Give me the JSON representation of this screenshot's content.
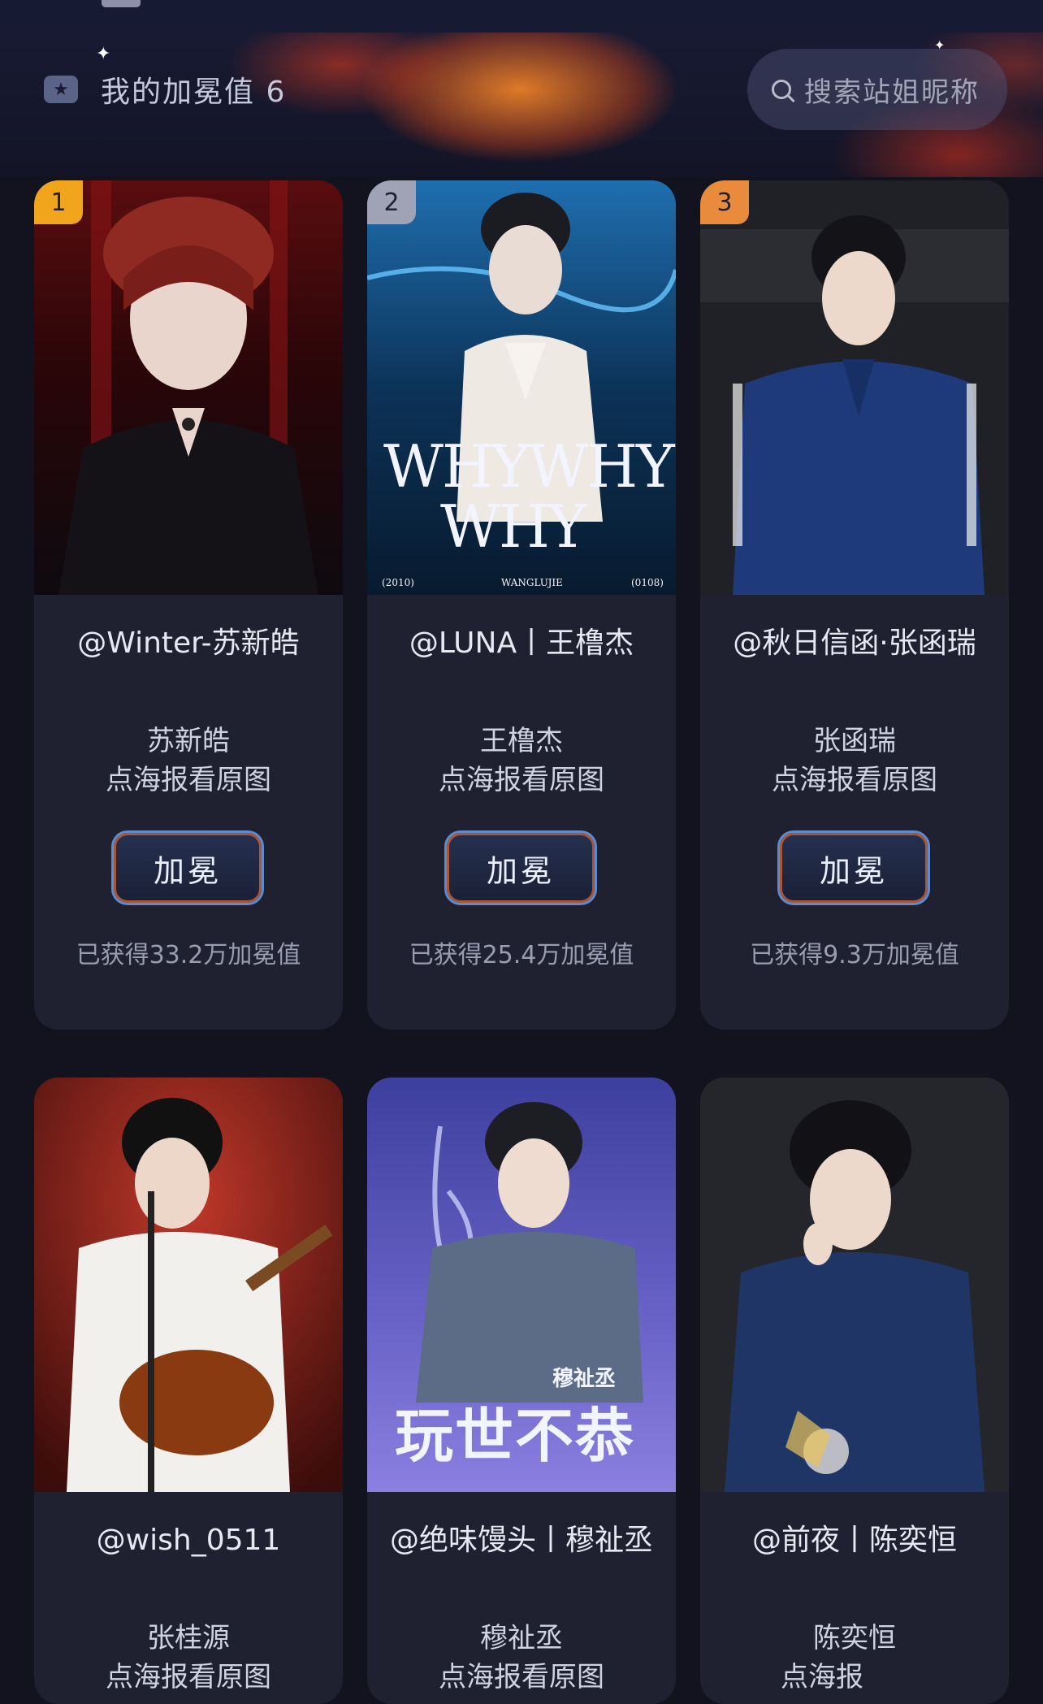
{
  "header": {
    "my_value_label": "我的加冕值 6",
    "search_placeholder": "搜索站姐昵称"
  },
  "cards": [
    {
      "rank": "1",
      "nickname": "@Winter-苏新皓",
      "real_name": "苏新皓",
      "hint": "点海报看原图",
      "button": "加冕",
      "earned": "已获得33.2万加冕值"
    },
    {
      "rank": "2",
      "nickname": "@LUNA丨王橹杰",
      "real_name": "王橹杰",
      "hint": "点海报看原图",
      "button": "加冕",
      "earned": "已获得25.4万加冕值",
      "poster_text": {
        "title_line1": "WHYWHY",
        "title_line2": "WHY",
        "bottom_left": "(2010)",
        "bottom_center": "WANGLUJIE",
        "bottom_right": "(0108)"
      }
    },
    {
      "rank": "3",
      "nickname": "@秋日信函·张函瑞",
      "real_name": "张函瑞",
      "hint": "点海报看原图",
      "button": "加冕",
      "earned": "已获得9.3万加冕值"
    },
    {
      "nickname": "@wish_0511",
      "real_name": "张桂源",
      "hint": "点海报看原图"
    },
    {
      "nickname": "@绝味馒头丨穆祉丞",
      "real_name": "穆祉丞",
      "hint": "点海报看原图",
      "poster_text": {
        "name": "穆祉丞",
        "title": "玩世不恭"
      }
    },
    {
      "nickname": "@前夜丨陈奕恒",
      "real_name": "陈奕恒",
      "hint": "点海报"
    }
  ],
  "colors": {
    "background": "#12131f",
    "card": "#1f2030",
    "button_border": "#5d8bd0",
    "rank_gold": "#f0a51c",
    "rank_silver": "#9fa3b5",
    "rank_bronze": "#e98b3c"
  }
}
